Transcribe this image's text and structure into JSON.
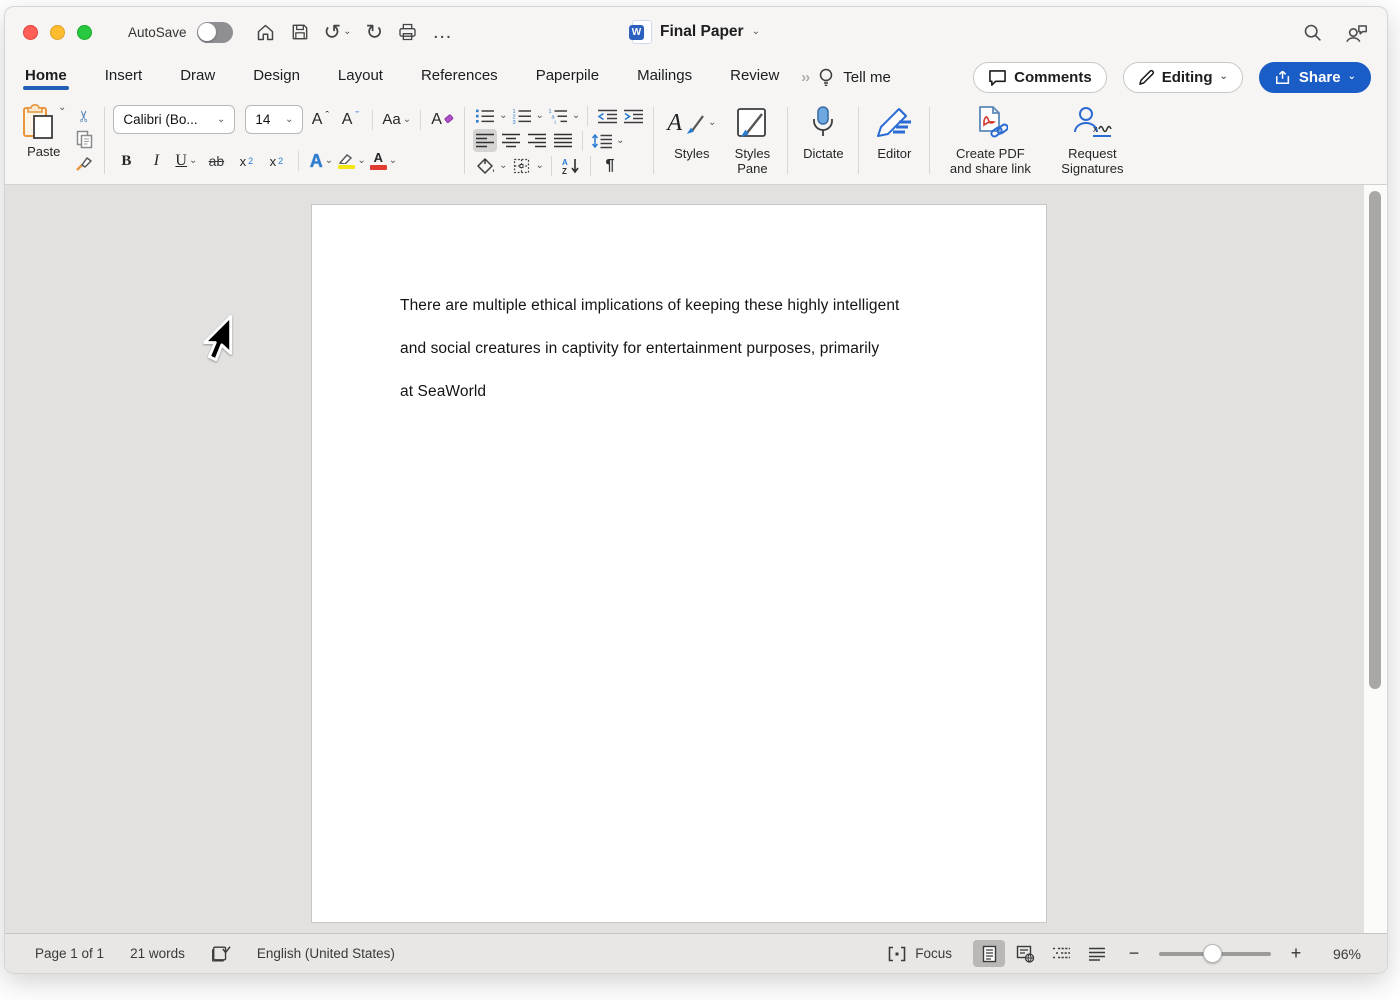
{
  "colors": {
    "accent": "#2b7cd3",
    "share": "#1a5dc6",
    "underline": "#2160b4",
    "hl-yellow": "#f3e612",
    "font-red": "#e03c31"
  },
  "titlebar": {
    "autosave_label": "AutoSave",
    "doc_title": "Final Paper",
    "more_glyph": "…"
  },
  "tabs": [
    {
      "label": "Home"
    },
    {
      "label": "Insert"
    },
    {
      "label": "Draw"
    },
    {
      "label": "Design"
    },
    {
      "label": "Layout"
    },
    {
      "label": "References"
    },
    {
      "label": "Paperpile"
    },
    {
      "label": "Mailings"
    },
    {
      "label": "Review"
    }
  ],
  "tab_extras": {
    "overflow_glyph": "››",
    "tell_me": "Tell me"
  },
  "top_actions": {
    "comments": "Comments",
    "editing": "Editing",
    "share": "Share"
  },
  "ribbon": {
    "paste_label": "Paste",
    "font_name": "Calibri (Bo...",
    "font_size": "14",
    "glyphs": {
      "cut": "✂",
      "grow": "A",
      "grow_caret": "ˆ",
      "shrink": "A",
      "shrink_caret": "ˇ",
      "change_case": "Aa",
      "clear_format": "A",
      "bold": "B",
      "italic": "I",
      "underline": "U",
      "strike": "ab",
      "sub_base": "x",
      "sub_small": "2",
      "sup_base": "x",
      "sup_small": "2",
      "text_effects": "A",
      "font_color": "A",
      "sort_a": "A",
      "sort_z": "Z",
      "pilcrow": "¶",
      "styles_a": "A"
    },
    "styles_label": "Styles",
    "styles_pane_line1": "Styles",
    "styles_pane_line2": "Pane",
    "dictate_label": "Dictate",
    "editor_label": "Editor",
    "pdf_line1": "Create PDF",
    "pdf_line2": "and share link",
    "sig_line1": "Request",
    "sig_line2": "Signatures"
  },
  "document": {
    "lines": [
      "There are multiple ethical implications of keeping these highly intelligent",
      "and social creatures in captivity for entertainment purposes, primarily",
      "at SeaWorld"
    ]
  },
  "statusbar": {
    "page": "Page 1 of 1",
    "words": "21 words",
    "language": "English (United States)",
    "focus_label": "Focus",
    "zoom_value": "96%"
  }
}
